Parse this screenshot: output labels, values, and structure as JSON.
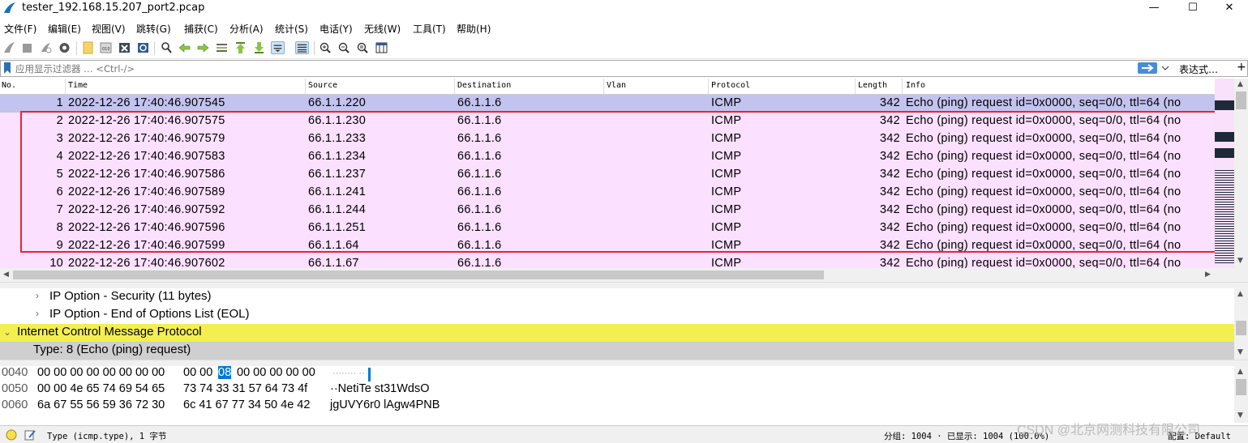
{
  "window": {
    "title": "tester_192.168.15.207_port2.pcap",
    "minimize": "—",
    "maximize": "☐",
    "close": "✕"
  },
  "menu": [
    "文件(F)",
    "编辑(E)",
    "视图(V)",
    "跳转(G)",
    "捕获(C)",
    "分析(A)",
    "统计(S)",
    "电话(Y)",
    "无线(W)",
    "工具(T)",
    "帮助(H)"
  ],
  "filter": {
    "placeholder": "应用显示过滤器 … <Ctrl-/>",
    "expression_label": "表达式…",
    "add_label": "+"
  },
  "columns": [
    "No.",
    "Time",
    "Source",
    "Destination",
    "Vlan",
    "Protocol",
    "Length",
    "Info"
  ],
  "packets": [
    {
      "no": "1",
      "time": "2022-12-26 17:40:46.907545",
      "src": "66.1.1.220",
      "dst": "66.1.1.6",
      "vlan": "",
      "proto": "ICMP",
      "len": "342",
      "info": "Echo (ping) request  id=0x0000, seq=0/0, ttl=64 (no"
    },
    {
      "no": "2",
      "time": "2022-12-26 17:40:46.907575",
      "src": "66.1.1.230",
      "dst": "66.1.1.6",
      "vlan": "",
      "proto": "ICMP",
      "len": "342",
      "info": "Echo (ping) request  id=0x0000, seq=0/0, ttl=64 (no"
    },
    {
      "no": "3",
      "time": "2022-12-26 17:40:46.907579",
      "src": "66.1.1.233",
      "dst": "66.1.1.6",
      "vlan": "",
      "proto": "ICMP",
      "len": "342",
      "info": "Echo (ping) request  id=0x0000, seq=0/0, ttl=64 (no"
    },
    {
      "no": "4",
      "time": "2022-12-26 17:40:46.907583",
      "src": "66.1.1.234",
      "dst": "66.1.1.6",
      "vlan": "",
      "proto": "ICMP",
      "len": "342",
      "info": "Echo (ping) request  id=0x0000, seq=0/0, ttl=64 (no"
    },
    {
      "no": "5",
      "time": "2022-12-26 17:40:46.907586",
      "src": "66.1.1.237",
      "dst": "66.1.1.6",
      "vlan": "",
      "proto": "ICMP",
      "len": "342",
      "info": "Echo (ping) request  id=0x0000, seq=0/0, ttl=64 (no"
    },
    {
      "no": "6",
      "time": "2022-12-26 17:40:46.907589",
      "src": "66.1.1.241",
      "dst": "66.1.1.6",
      "vlan": "",
      "proto": "ICMP",
      "len": "342",
      "info": "Echo (ping) request  id=0x0000, seq=0/0, ttl=64 (no"
    },
    {
      "no": "7",
      "time": "2022-12-26 17:40:46.907592",
      "src": "66.1.1.244",
      "dst": "66.1.1.6",
      "vlan": "",
      "proto": "ICMP",
      "len": "342",
      "info": "Echo (ping) request  id=0x0000, seq=0/0, ttl=64 (no"
    },
    {
      "no": "8",
      "time": "2022-12-26 17:40:46.907596",
      "src": "66.1.1.251",
      "dst": "66.1.1.6",
      "vlan": "",
      "proto": "ICMP",
      "len": "342",
      "info": "Echo (ping) request  id=0x0000, seq=0/0, ttl=64 (no"
    },
    {
      "no": "9",
      "time": "2022-12-26 17:40:46.907599",
      "src": "66.1.1.64",
      "dst": "66.1.1.6",
      "vlan": "",
      "proto": "ICMP",
      "len": "342",
      "info": "Echo (ping) request  id=0x0000, seq=0/0, ttl=64 (no"
    },
    {
      "no": "10",
      "time": "2022-12-26 17:40:46.907602",
      "src": "66.1.1.67",
      "dst": "66.1.1.6",
      "vlan": "",
      "proto": "ICMP",
      "len": "342",
      "info": "Echo (ping) request  id=0x0000, seq=0/0, ttl=64 (no"
    }
  ],
  "details": [
    {
      "text": "IP Option - Security (11 bytes)",
      "expanded": false
    },
    {
      "text": "IP Option - End of Options List (EOL)",
      "expanded": false
    },
    {
      "text": "Internet Control Message Protocol",
      "expanded": true
    },
    {
      "text": "Type: 8 (Echo (ping) request)",
      "expanded": null
    }
  ],
  "hex": [
    {
      "offset": "0040",
      "bytes_a": "00 00 00 00 00 00 00 00",
      "bytes_b1": "00 00",
      "bytes_sel": "08",
      "bytes_b2": "00 00 00 00 00",
      "ascii": "········ ··"
    },
    {
      "offset": "0050",
      "bytes_a": "00 00 4e 65 74 69 54 65",
      "bytes_b1": "73 74 33 31 57 64 73 4f",
      "bytes_sel": "",
      "bytes_b2": "",
      "ascii": "··NetiTe st31WdsO"
    },
    {
      "offset": "0060",
      "bytes_a": "6a 67 55 56 59 36 72 30",
      "bytes_b1": "6c 41 67 77 34 50 4e 42",
      "bytes_sel": "",
      "bytes_b2": "",
      "ascii": "jgUVY6r0 lAgw4PNB"
    }
  ],
  "status": {
    "field": "Type (icmp.type), 1 字节",
    "packets": "分组: 1004 · 已显示: 1004 (100.0%)",
    "profile": "配置: Default"
  },
  "watermark": "CSDN @北京网测科技有限公司",
  "colors": {
    "row_selected": "#c3c3f0",
    "row_icmp": "#fce0ff",
    "highlight_bar": "#f0ef50",
    "hex_selected": "#0078d7",
    "red_box": "#e8262c"
  }
}
